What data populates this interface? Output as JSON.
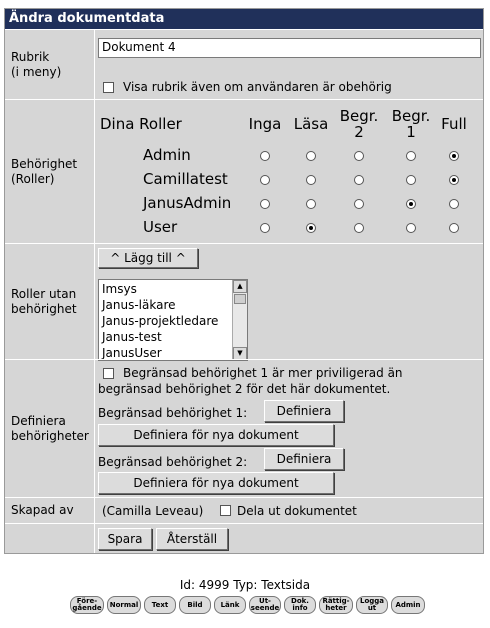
{
  "title": "Ändra dokumentdata",
  "rubrik": {
    "label": "Rubrik\n(i meny)",
    "value": "Dokument 4",
    "checkbox_label": "Visa rubrik även om användaren är obehörig"
  },
  "behorighet": {
    "label": "Behörighet\n(Roller)",
    "roles_header": "Dina Roller",
    "columns": [
      "Inga",
      "Läsa",
      "Begr. 2",
      "Begr. 1",
      "Full"
    ],
    "roles": [
      {
        "name": "Admin",
        "selected": 4
      },
      {
        "name": "Camillatest",
        "selected": 4
      },
      {
        "name": "JanusAdmin",
        "selected": 3
      },
      {
        "name": "User",
        "selected": 1
      }
    ]
  },
  "roller_utan": {
    "label": "Roller utan\nbehörighet",
    "add_button": "^ Lägg till ^",
    "items": [
      "Imsys",
      "Janus-läkare",
      "Janus-projektledare",
      "Janus-test",
      "JanusUser"
    ]
  },
  "definiera": {
    "label": "Definiera\nbehörigheter",
    "checkbox_label_line1": "Begränsad behörighet 1 är mer priviligerad än",
    "checkbox_label_line2": "begränsad behörighet 2 för det här dokumentet.",
    "b1_label": "Begränsad behörighet 1:",
    "b2_label": "Begränsad behörighet 2:",
    "define_button": "Definiera",
    "define_new_button": "Definiera för nya dokument"
  },
  "skapad": {
    "label": "Skapad av",
    "value": "(Camilla Leveau)",
    "share_label": "Dela ut dokumentet"
  },
  "actions": {
    "save": "Spara",
    "reset": "Återställ"
  },
  "footer": {
    "info": "Id: 4999 Typ: Textsida",
    "nav": [
      "Före-\ngående",
      "Normal",
      "Text",
      "Bild",
      "Länk",
      "Ut-\nseende",
      "Dok.\ninfo",
      "Rättig-\nheter",
      "Logga\nut",
      "Admin"
    ]
  }
}
